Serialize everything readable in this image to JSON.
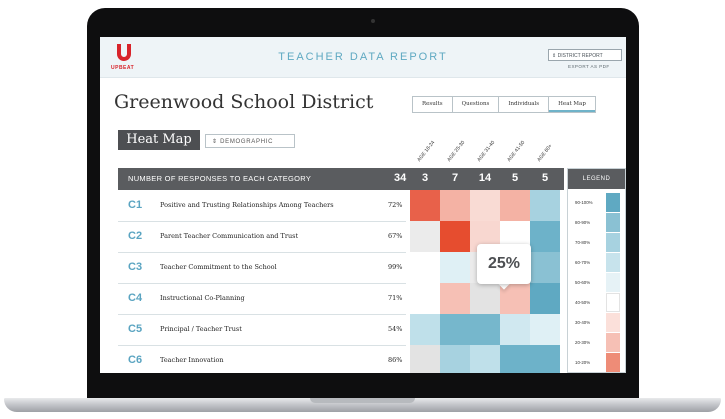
{
  "app": {
    "logo_text": "UPBEAT",
    "report_title": "TEACHER DATA REPORT"
  },
  "header": {
    "district_button": "⇕  DISTRICT REPORT",
    "export": "EXPORT AS PDF"
  },
  "district_name": "Greenwood School District",
  "tabs": [
    "Results",
    "Questions",
    "Individuals",
    "Heat Map"
  ],
  "active_tab": "Heat Map",
  "view_label": "Heat Map",
  "demographic_select": "⇕  DEMOGRAPHIC",
  "age_groups": [
    "AGE 18-24",
    "AGE 25-30",
    "AGE 31-40",
    "AGE 41-50",
    "AGE 60+"
  ],
  "table": {
    "header_title": "NUMBER OF RESPONSES TO EACH CATEGORY",
    "total": "34",
    "counts": [
      "3",
      "7",
      "14",
      "5",
      "5"
    ],
    "rows": [
      {
        "code": "C1",
        "label": "Positive and Trusting Relationships Among Teachers",
        "pct": "72%"
      },
      {
        "code": "C2",
        "label": "Parent Teacher Communication and Trust",
        "pct": "67%"
      },
      {
        "code": "C3",
        "label": "Teacher Commitment to the School",
        "pct": "99%"
      },
      {
        "code": "C4",
        "label": "Instructional Co-Planning",
        "pct": "71%"
      },
      {
        "code": "C5",
        "label": "Principal / Teacher Trust",
        "pct": "54%"
      },
      {
        "code": "C6",
        "label": "Teacher Innovation",
        "pct": "86%"
      }
    ],
    "heat_colors": [
      [
        "#e8614a",
        "#f4b2a4",
        "#f9dbd4",
        "#f4b2a4",
        "#a7d2e0"
      ],
      [
        "#ebebeb",
        "#e64d2f",
        "#f8d7d0",
        "#ffffff",
        "#6db2c9"
      ],
      [
        "#ffffff",
        "#dff0f5",
        "#ebebeb",
        "#f9dbd4",
        "#8ac1d3"
      ],
      [
        "#ffffff",
        "#f6c0b5",
        "#e3e3e3",
        "#f6c0b5",
        "#5fa9c2"
      ],
      [
        "#bfe0ea",
        "#76b7cc",
        "#76b7cc",
        "#d0e8f0",
        "#dff0f5"
      ],
      [
        "#e3e3e3",
        "#a7d2e0",
        "#bfe0ea",
        "#6db2c9",
        "#6db2c9"
      ]
    ]
  },
  "tooltip": "25%",
  "legend": {
    "title": "LEGEND",
    "items": [
      {
        "label": "90-100%",
        "color": "#5fa9c2"
      },
      {
        "label": "80-90%",
        "color": "#8ac1d3"
      },
      {
        "label": "70-80%",
        "color": "#a7d2e0"
      },
      {
        "label": "60-70%",
        "color": "#c7e3ec"
      },
      {
        "label": "50-60%",
        "color": "#e6f2f6"
      },
      {
        "label": "40-50%",
        "color": "#ffffff"
      },
      {
        "label": "30-40%",
        "color": "#fbe0da"
      },
      {
        "label": "20-30%",
        "color": "#f6c0b5"
      },
      {
        "label": "10-20%",
        "color": "#ee8c77"
      }
    ]
  },
  "colors": {
    "accent": "#5fa9c2",
    "brand_red": "#d8232a",
    "header_dark": "#5a5c5f"
  }
}
